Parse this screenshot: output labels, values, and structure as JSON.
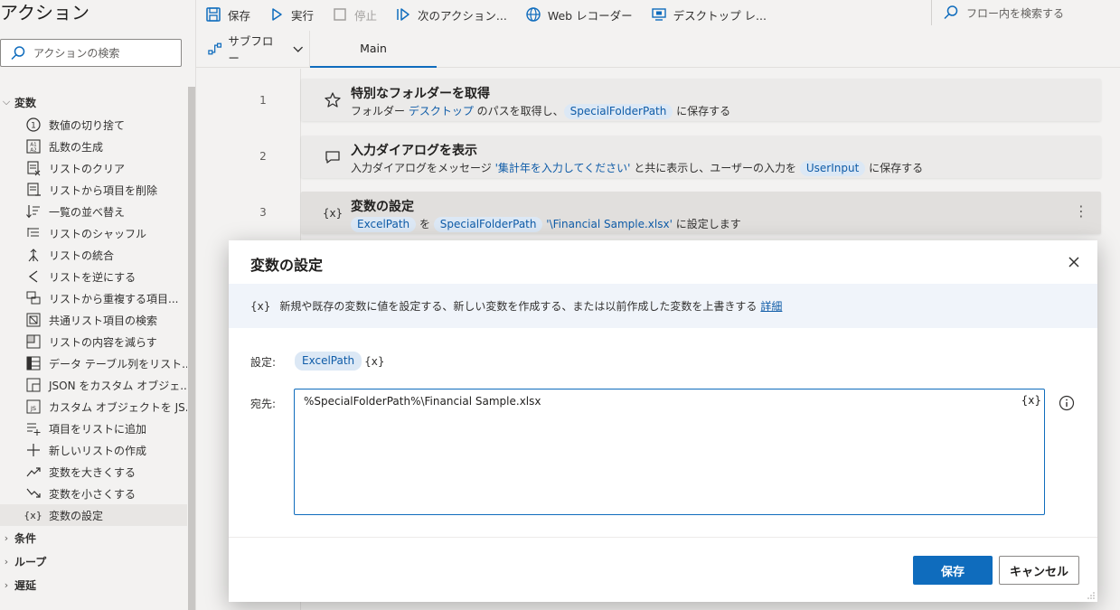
{
  "actions_pane": {
    "title": "アクション",
    "search_placeholder": "アクションの検索",
    "groups": {
      "variables": "変数",
      "conditions": "条件",
      "loops": "ループ",
      "wait": "遅延"
    },
    "items": [
      {
        "label": "数値の切り捨て",
        "icon": "circle-one-icon"
      },
      {
        "label": "乱数の生成",
        "icon": "random-icon"
      },
      {
        "label": "リストのクリア",
        "icon": "list-clear-icon"
      },
      {
        "label": "リストから項目を削除",
        "icon": "list-remove-icon"
      },
      {
        "label": "一覧の並べ替え",
        "icon": "sort-icon"
      },
      {
        "label": "リストのシャッフル",
        "icon": "shuffle-icon"
      },
      {
        "label": "リストの統合",
        "icon": "merge-icon"
      },
      {
        "label": "リストを逆にする",
        "icon": "reverse-icon"
      },
      {
        "label": "リストから重複する項目...",
        "icon": "duplicate-icon"
      },
      {
        "label": "共通リスト項目の検索",
        "icon": "common-items-icon"
      },
      {
        "label": "リストの内容を減らす",
        "icon": "subtract-list-icon"
      },
      {
        "label": "データ テーブル列をリスト...",
        "icon": "table-column-icon"
      },
      {
        "label": "JSON をカスタム オブジェ...",
        "icon": "json-icon"
      },
      {
        "label": "カスタム オブジェクトを JS...",
        "icon": "js-icon"
      },
      {
        "label": "項目をリストに追加",
        "icon": "add-item-icon"
      },
      {
        "label": "新しいリストの作成",
        "icon": "plus-icon"
      },
      {
        "label": "変数を大きくする",
        "icon": "trend-up-icon"
      },
      {
        "label": "変数を小さくする",
        "icon": "trend-down-icon"
      },
      {
        "label": "変数の設定",
        "icon": "variable-icon",
        "selected": true
      }
    ]
  },
  "toolbar": {
    "save": "保存",
    "run": "実行",
    "stop": "停止",
    "next_action": "次のアクション...",
    "web_recorder": "Web レコーダー",
    "desktop": "デスクトップ レ...",
    "flow_search_placeholder": "フロー内を検索する"
  },
  "tabs": {
    "subflow": "サブフロー",
    "main": "Main"
  },
  "flow": [
    {
      "num": "1",
      "title": "特別なフォルダーを取得",
      "desc_a": "フォルダー ",
      "desc_link": "デスクトップ",
      "desc_b": " のパスを取得し、",
      "token": "SpecialFolderPath",
      "desc_c": " に保存する"
    },
    {
      "num": "2",
      "title": "入力ダイアログを表示",
      "desc_a": "入力ダイアログをメッセージ ",
      "desc_link": "'集計年を入力してください'",
      "desc_b": " と共に表示し、ユーザーの入力を ",
      "token": "UserInput",
      "desc_c": " に保存する"
    },
    {
      "num": "3",
      "title": "変数の設定",
      "token1": "ExcelPath",
      "desc_a": " を ",
      "token2": "SpecialFolderPath",
      "desc_link": " '\\Financial Sample.xlsx'",
      "desc_c": " に設定します"
    }
  ],
  "dialog": {
    "title": "変数の設定",
    "info": "新規や既存の変数に値を設定する、新しい変数を作成する、または以前作成した変数を上書きする",
    "info_link": "詳細",
    "var_icon": "{x}",
    "set_label": "設定:",
    "set_value": "ExcelPath",
    "to_label": "宛先:",
    "to_value": "%SpecialFolderPath%\\Financial Sample.xlsx",
    "save": "保存",
    "cancel": "キャンセル"
  }
}
